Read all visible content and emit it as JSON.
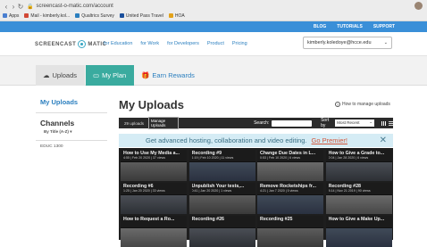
{
  "browser": {
    "url": "screencast-o-matic.com/account",
    "bookmarks": [
      {
        "label": "Apps",
        "color": "#4a7fd0"
      },
      {
        "label": "Mail - kimberly.kol...",
        "color": "#d14836"
      },
      {
        "label": "Qualtrics Survey",
        "color": "#2b7fbf"
      },
      {
        "label": "United Pass Travel",
        "color": "#1a4f9c"
      },
      {
        "label": "HOA",
        "color": "#e3a21a"
      }
    ]
  },
  "topstrip": {
    "links": [
      "BLOG",
      "TUTORIALS",
      "SUPPORT"
    ]
  },
  "header": {
    "logo_left": "SCREENCAST",
    "logo_right": "MATIC",
    "nav": [
      "for Education",
      "for Work",
      "for Developers",
      "Product",
      "Pricing"
    ],
    "user_email": "kimberly.koledoye@hcce.edu"
  },
  "tabs": {
    "uploads": "Uploads",
    "plan": "My Plan",
    "rewards": "Earn Rewards"
  },
  "sidebar": {
    "title": "My Uploads",
    "channels_heading": "Channels",
    "sort": "By Title (A-Z)",
    "items": [
      "EDUC 1300"
    ]
  },
  "main": {
    "title": "My Uploads",
    "howto": "How to manage uploads"
  },
  "toolbar": {
    "count": "29 uploads",
    "manage": "Manage Uploads",
    "search_label": "Search:",
    "sort_label": "Sort by",
    "sort_value": "Most Recent"
  },
  "promo": {
    "text": "Get advanced hosting, collaboration and video editing.",
    "link": "Go Premier!"
  },
  "cards": [
    {
      "title": "How to Use My Media a...",
      "meta": "4:55 | Feb 20 2020 | 37 views"
    },
    {
      "title": "Recording #9",
      "meta": "1:19 | Feb 10 2020 | 11 views"
    },
    {
      "title": "Change Due Dates in L...",
      "meta": "0:53 | Feb 10 2020 | 6 views"
    },
    {
      "title": "How to Give a Grade to...",
      "meta": "2:04 | Jan 28 2020 | 6 views"
    },
    {
      "title": "Recording #6",
      "meta": "1:25 | Jan 20 2020 | 33 views"
    },
    {
      "title": "Unpublish Your tests,...",
      "meta": "0:41 | Jan 20 2020 | 1 views"
    },
    {
      "title": "Remove Rocketships fr...",
      "meta": "4:21 | Jan 7 2020 | 5 views"
    },
    {
      "title": "Recording #28",
      "meta": "8:14 | Nov 21 2019 | 90 views"
    },
    {
      "title": "How to Request a Ro...",
      "meta": ""
    },
    {
      "title": "Recording #26",
      "meta": ""
    },
    {
      "title": "Recording #25",
      "meta": ""
    },
    {
      "title": "How to Give a Make Up...",
      "meta": ""
    }
  ]
}
